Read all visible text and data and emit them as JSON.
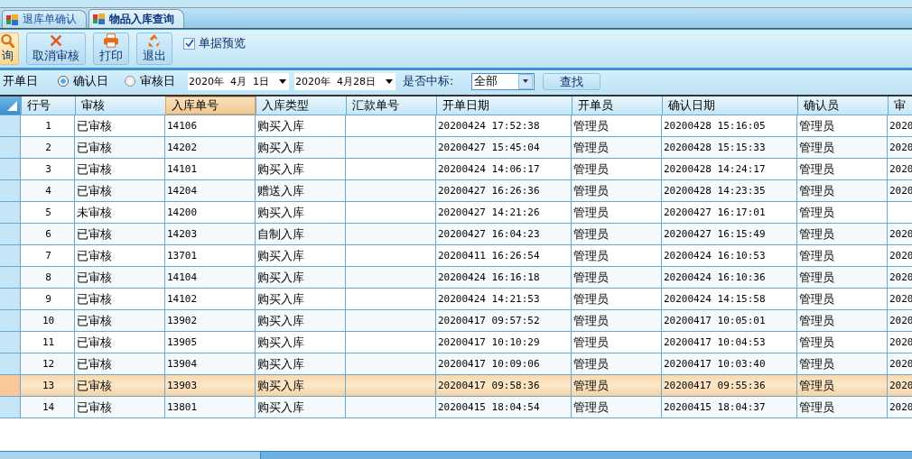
{
  "tabs": [
    {
      "label": "退库单确认",
      "selected": false
    },
    {
      "label": "物品入库查询",
      "selected": true
    }
  ],
  "toolbar": {
    "buttons": [
      {
        "label": "询",
        "kind": "search",
        "active": true
      },
      {
        "label": "取消审核",
        "kind": "cancel",
        "active": false
      },
      {
        "label": "打印",
        "kind": "print",
        "active": false
      },
      {
        "label": "退出",
        "kind": "exit",
        "active": false
      }
    ],
    "preview": {
      "label": "单据预览",
      "checked": true
    }
  },
  "filter": {
    "label": "开单日",
    "radios": [
      {
        "label": "确认日",
        "selected": true
      },
      {
        "label": "审核日",
        "selected": false
      }
    ],
    "date_from": "2020年  4月  1日",
    "date_to": "2020年  4月28日",
    "bid_label": "是否中标:",
    "bid_value": "全部",
    "find_button": "查找"
  },
  "table": {
    "columns": [
      {
        "label": "行号",
        "selected": false
      },
      {
        "label": "审核",
        "selected": false
      },
      {
        "label": "入库单号",
        "selected": true
      },
      {
        "label": "入库类型",
        "selected": false
      },
      {
        "label": "汇款单号",
        "selected": false
      },
      {
        "label": "开单日期",
        "selected": false
      },
      {
        "label": "开单员",
        "selected": false
      },
      {
        "label": "确认日期",
        "selected": false
      },
      {
        "label": "确认员",
        "selected": false
      },
      {
        "label": "审",
        "selected": false
      }
    ],
    "rows": [
      {
        "cells": [
          "1",
          "已审核",
          "14106",
          "购买入库",
          "",
          "20200424 17:52:38",
          "管理员",
          "20200428 15:16:05",
          "管理员",
          "2020"
        ],
        "selected": false
      },
      {
        "cells": [
          "2",
          "已审核",
          "14202",
          "购买入库",
          "",
          "20200427 15:45:04",
          "管理员",
          "20200428 15:15:33",
          "管理员",
          "2020"
        ],
        "selected": false
      },
      {
        "cells": [
          "3",
          "已审核",
          "14101",
          "购买入库",
          "",
          "20200424 14:06:17",
          "管理员",
          "20200428 14:24:17",
          "管理员",
          "2020"
        ],
        "selected": false
      },
      {
        "cells": [
          "4",
          "已审核",
          "14204",
          "赠送入库",
          "",
          "20200427 16:26:36",
          "管理员",
          "20200428 14:23:35",
          "管理员",
          "2020"
        ],
        "selected": false
      },
      {
        "cells": [
          "5",
          "未审核",
          "14200",
          "购买入库",
          "",
          "20200427 14:21:26",
          "管理员",
          "20200427 16:17:01",
          "管理员",
          ""
        ],
        "selected": false
      },
      {
        "cells": [
          "6",
          "已审核",
          "14203",
          "自制入库",
          "",
          "20200427 16:04:23",
          "管理员",
          "20200427 16:15:49",
          "管理员",
          "2020"
        ],
        "selected": false
      },
      {
        "cells": [
          "7",
          "已审核",
          "13701",
          "购买入库",
          "",
          "20200411 16:26:54",
          "管理员",
          "20200424 16:10:53",
          "管理员",
          "2020"
        ],
        "selected": false
      },
      {
        "cells": [
          "8",
          "已审核",
          "14104",
          "购买入库",
          "",
          "20200424 16:16:18",
          "管理员",
          "20200424 16:10:36",
          "管理员",
          "2020"
        ],
        "selected": false
      },
      {
        "cells": [
          "9",
          "已审核",
          "14102",
          "购买入库",
          "",
          "20200424 14:21:53",
          "管理员",
          "20200424 14:15:58",
          "管理员",
          "2020"
        ],
        "selected": false
      },
      {
        "cells": [
          "10",
          "已审核",
          "13902",
          "购买入库",
          "",
          "20200417 09:57:52",
          "管理员",
          "20200417 10:05:01",
          "管理员",
          "2020"
        ],
        "selected": false
      },
      {
        "cells": [
          "11",
          "已审核",
          "13905",
          "购买入库",
          "",
          "20200417 10:10:29",
          "管理员",
          "20200417 10:04:53",
          "管理员",
          "2020"
        ],
        "selected": false
      },
      {
        "cells": [
          "12",
          "已审核",
          "13904",
          "购买入库",
          "",
          "20200417 10:09:06",
          "管理员",
          "20200417 10:03:40",
          "管理员",
          "2020"
        ],
        "selected": false
      },
      {
        "cells": [
          "13",
          "已审核",
          "13903",
          "购买入库",
          "",
          "20200417 09:58:36",
          "管理员",
          "20200417 09:55:36",
          "管理员",
          "2020"
        ],
        "selected": true
      },
      {
        "cells": [
          "14",
          "已审核",
          "13801",
          "购买入库",
          "",
          "20200415 18:04:54",
          "管理员",
          "20200415 18:04:37",
          "管理员",
          "2020"
        ],
        "selected": false
      }
    ]
  }
}
